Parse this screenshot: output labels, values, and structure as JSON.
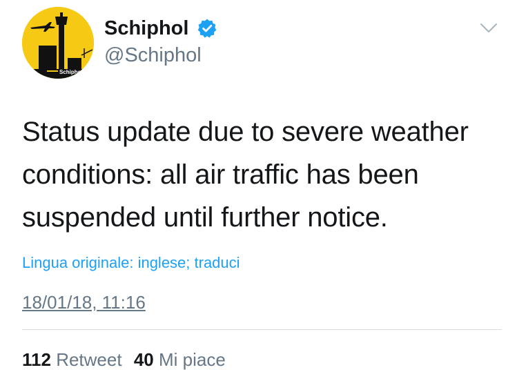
{
  "account": {
    "display_name": "Schiphol",
    "handle": "@Schiphol",
    "avatar_logo_text": "Schiphol",
    "verified": true
  },
  "icons": {
    "verified": "verified-badge-icon",
    "menu": "chevron-down-icon"
  },
  "tweet": {
    "lines": [
      "Status update due to severe weather",
      "conditions: all air traffic has been",
      "suspended until further notice."
    ],
    "translate_link": "Lingua originale: inglese; traduci",
    "timestamp": "18/01/18, 11:16"
  },
  "stats": {
    "retweets_count": "112",
    "retweets_label": "Retweet",
    "likes_count": "40",
    "likes_label": "Mi piace"
  },
  "colors": {
    "link_blue": "#1da1f2",
    "secondary_text": "#657786",
    "avatar_yellow": "#f6c915",
    "primary_text": "#14171a"
  }
}
